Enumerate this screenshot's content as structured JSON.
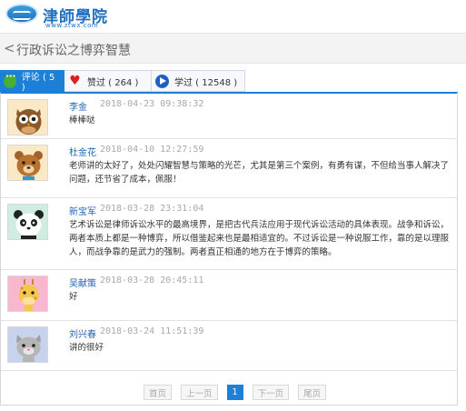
{
  "site": {
    "logo_text": "津師學院",
    "logo_url": "www.ztwx.com"
  },
  "titlebar": {
    "back_symbol": "<",
    "title": "行政诉讼之博弈智慧"
  },
  "tabs": [
    {
      "label": "评论 ( 5 )",
      "icon": "chat-icon",
      "active": true
    },
    {
      "label": "赞过 ( 264 )",
      "icon": "heart-icon",
      "active": false
    },
    {
      "label": "学过 ( 12548 )",
      "icon": "play-icon",
      "active": false
    }
  ],
  "comments": [
    {
      "name": "李金",
      "time": "2018-04-23 09:38:32",
      "text": "棒棒哒",
      "avatar": "owl-avatar"
    },
    {
      "name": "杜金花",
      "time": "2018-04-10 12:27:59",
      "text": "老师讲的太好了，处处闪耀智慧与策略的光芒，尤其是第三个案例，有勇有谋，不但给当事人解决了问题，还节省了成本，佩服！",
      "avatar": "bear-avatar"
    },
    {
      "name": "新宝军",
      "time": "2018-03-28 23:31:04",
      "text": "艺术诉讼是律师诉讼水平的最高境界，是把古代兵法应用于现代诉讼活动的具体表现。战争和诉讼，两者本质上都是一种博弈，所以借鉴起来也是最相适宜的。不过诉讼是一种说服工作，靠的是以理服人，而战争靠的是武力的强制。两者直正相通的地方在于博弈的策略。",
      "avatar": "panda-avatar"
    },
    {
      "name": "吴献策",
      "time": "2018-03-28 20:45:11",
      "text": "好",
      "avatar": "giraffe-avatar"
    },
    {
      "name": "刘兴春",
      "time": "2018-03-24 11:51:39",
      "text": "讲的很好",
      "avatar": "cat-avatar"
    }
  ],
  "pagination": {
    "first": "首页",
    "prev": "上一页",
    "current": "1",
    "next": "下一页",
    "last": "尾页"
  },
  "colors": {
    "accent": "#1e7fd6",
    "name_blue": "#1f64b5",
    "time_gray": "#a9a9a9"
  }
}
